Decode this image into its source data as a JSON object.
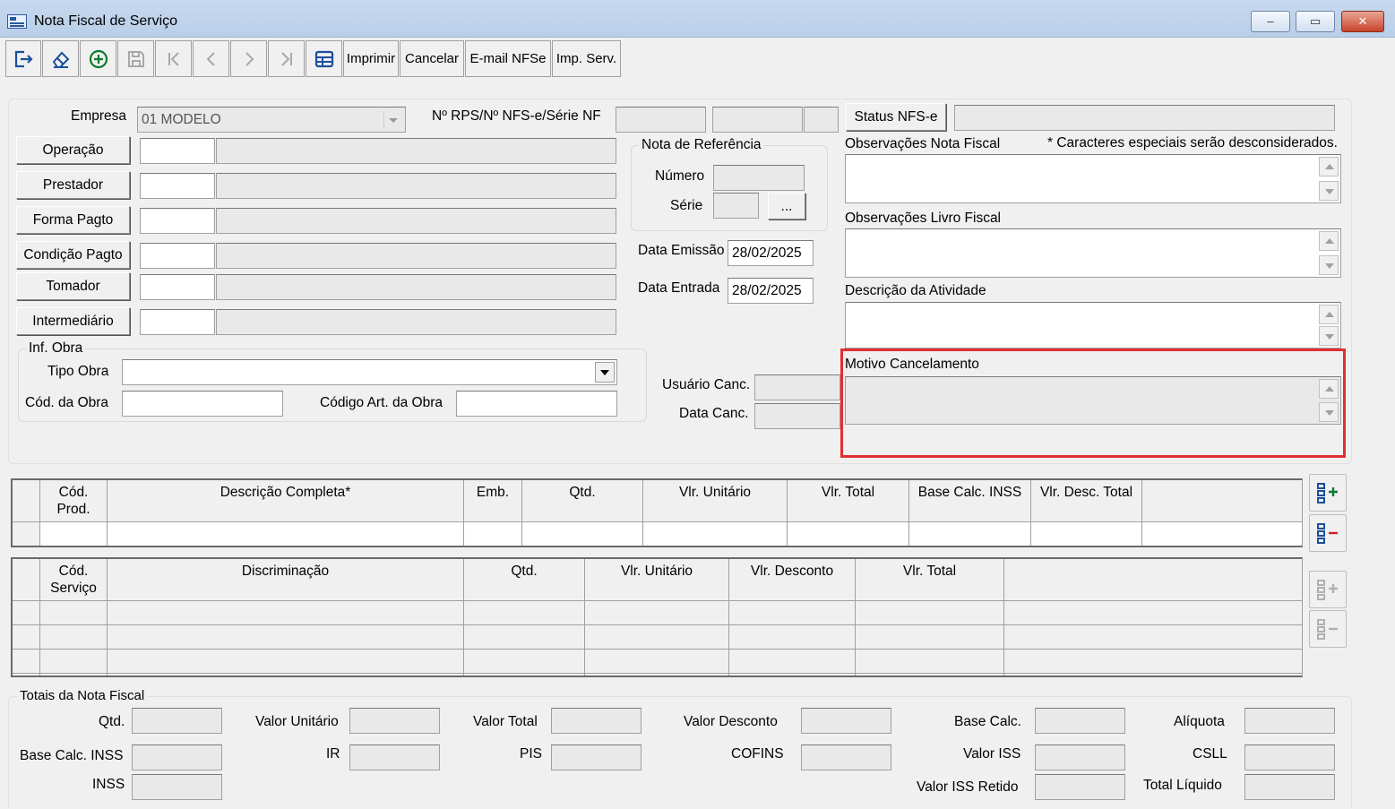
{
  "window": {
    "title": "Nota Fiscal de Serviço",
    "controls": {
      "minimize": "–",
      "maximize": "▭",
      "close": "✕"
    }
  },
  "toolbar": {
    "icons": [
      "exit-icon",
      "eraser-icon",
      "add-icon",
      "save-icon",
      "first-icon",
      "prev-icon",
      "next-icon",
      "last-icon",
      "table-icon"
    ],
    "imprimir": "Imprimir",
    "cancelar": "Cancelar",
    "email": "E-mail NFSe",
    "imp_serv": "Imp. Serv."
  },
  "header": {
    "empresa_label": "Empresa",
    "empresa_value": "01 MODELO",
    "rps_label": "Nº RPS/Nº NFS-e/Série NF",
    "status_button": "Status NFS-e"
  },
  "left_buttons": {
    "operacao": "Operação",
    "prestador": "Prestador",
    "forma_pagto": "Forma Pagto",
    "condicao_pagto": "Condição Pagto",
    "tomador": "Tomador",
    "intermediario": "Intermediário"
  },
  "nota_ref": {
    "title": "Nota de Referência",
    "numero_label": "Número",
    "serie_label": "Série",
    "browse": "..."
  },
  "datas": {
    "emissao_label": "Data Emissão",
    "emissao_value": "28/02/2025",
    "entrada_label": "Data Entrada",
    "entrada_value": "28/02/2025"
  },
  "obra": {
    "title": "Inf. Obra",
    "tipo_label": "Tipo Obra",
    "cod_label": "Cód. da Obra",
    "art_label": "Código Art. da Obra"
  },
  "cancel": {
    "usuario_label": "Usuário Canc.",
    "data_label": "Data Canc."
  },
  "memos": {
    "obs_nf_label": "Observações Nota Fiscal",
    "obs_note": "* Caracteres especiais serão desconsiderados.",
    "obs_livro_label": "Observações Livro Fiscal",
    "descricao_label": "Descrição da Atividade",
    "motivo_label": "Motivo Cancelamento",
    "highlight_color": "#e03030"
  },
  "products_grid": {
    "headers": [
      "Cód.\nProd.",
      "Descrição Completa*",
      "Emb.",
      "Qtd.",
      "Vlr. Unitário",
      "Vlr. Total",
      "Base Calc. INSS",
      "Vlr. Desc. Total"
    ]
  },
  "services_grid": {
    "headers": [
      "Cód.\nServiço",
      "Discriminação",
      "Qtd.",
      "Vlr. Unitário",
      "Vlr. Desconto",
      "Vlr. Total"
    ]
  },
  "totais": {
    "title": "Totais da Nota Fiscal",
    "qtd": "Qtd.",
    "valor_unitario": "Valor Unitário",
    "valor_total": "Valor Total",
    "valor_desconto": "Valor Desconto",
    "base_calc": "Base Calc.",
    "aliquota": "Alíquota",
    "base_calc_inss": "Base Calc. INSS",
    "ir": "IR",
    "pis": "PIS",
    "cofins": "COFINS",
    "valor_iss": "Valor ISS",
    "csll": "CSLL",
    "inss": "INSS",
    "valor_iss_retido": "Valor ISS Retido",
    "total_liquido": "Total Líquido"
  }
}
